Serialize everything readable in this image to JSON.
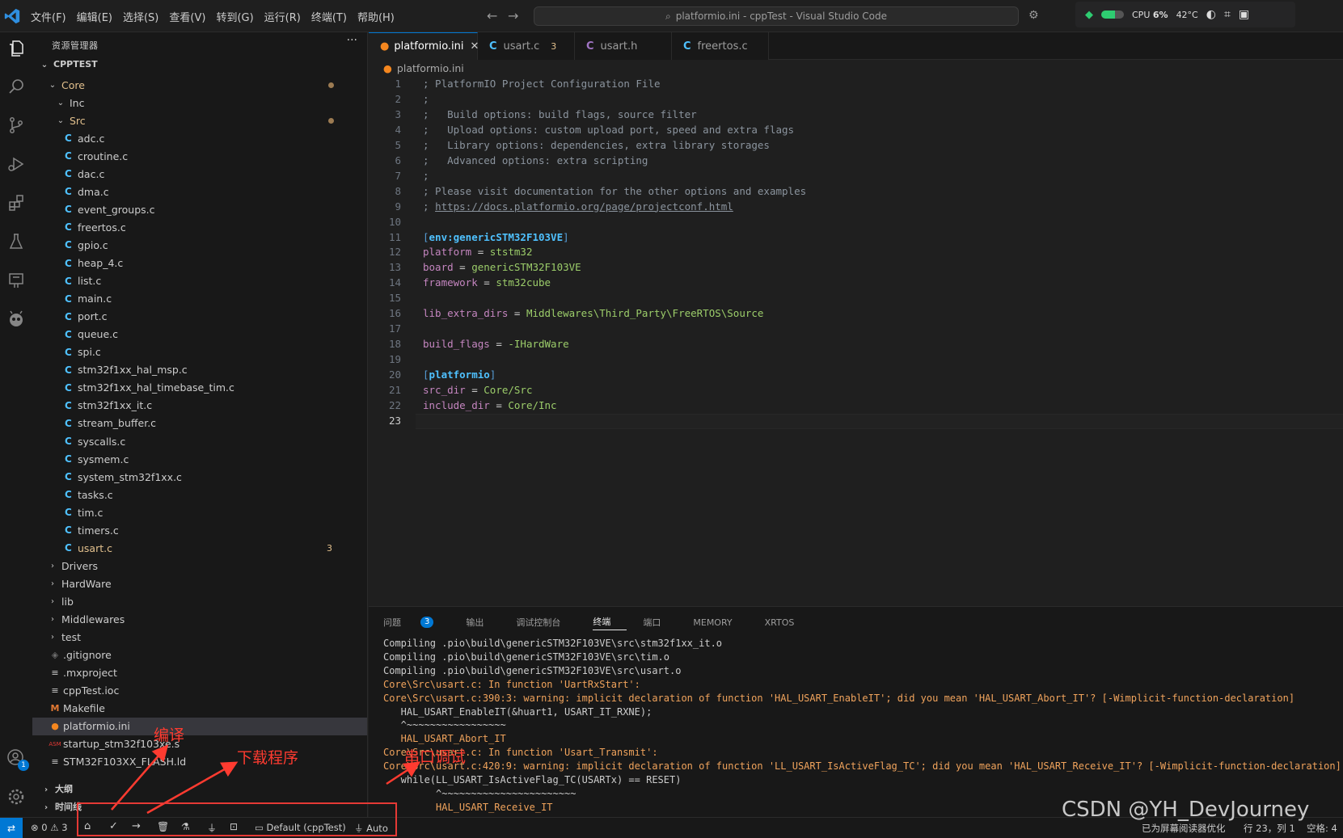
{
  "titlebar": {
    "menu": [
      "文件(F)",
      "编辑(E)",
      "选择(S)",
      "查看(V)",
      "转到(G)",
      "运行(R)",
      "终端(T)",
      "帮助(H)"
    ],
    "command_center": "platformio.ini - cppTest - Visual Studio Code",
    "cpu_label": "CPU",
    "cpu_value": "6%",
    "temperature": "42°C"
  },
  "activity_bar": {
    "icons": [
      "explorer-icon",
      "search-icon",
      "source-control-icon",
      "run-debug-icon",
      "extensions-icon",
      "testing-icon",
      "remote-explorer-icon",
      "platformio-icon"
    ],
    "bottom_icons": [
      "account-icon",
      "settings-icon"
    ],
    "account_badge": "1"
  },
  "sidebar": {
    "header": "资源管理器",
    "more": "···",
    "root": "CPPTEST",
    "items": [
      {
        "label": "Core",
        "type": "folder-open",
        "indent": 1,
        "color": "orange",
        "dot": true
      },
      {
        "label": "Inc",
        "type": "folder-open",
        "indent": 2
      },
      {
        "label": "Src",
        "type": "folder-open",
        "indent": 2,
        "color": "orange",
        "dot": true
      },
      {
        "label": "adc.c",
        "type": "c",
        "indent": 3
      },
      {
        "label": "croutine.c",
        "type": "c",
        "indent": 3
      },
      {
        "label": "dac.c",
        "type": "c",
        "indent": 3
      },
      {
        "label": "dma.c",
        "type": "c",
        "indent": 3
      },
      {
        "label": "event_groups.c",
        "type": "c",
        "indent": 3
      },
      {
        "label": "freertos.c",
        "type": "c",
        "indent": 3
      },
      {
        "label": "gpio.c",
        "type": "c",
        "indent": 3
      },
      {
        "label": "heap_4.c",
        "type": "c",
        "indent": 3
      },
      {
        "label": "list.c",
        "type": "c",
        "indent": 3
      },
      {
        "label": "main.c",
        "type": "c",
        "indent": 3
      },
      {
        "label": "port.c",
        "type": "c",
        "indent": 3
      },
      {
        "label": "queue.c",
        "type": "c",
        "indent": 3
      },
      {
        "label": "spi.c",
        "type": "c",
        "indent": 3
      },
      {
        "label": "stm32f1xx_hal_msp.c",
        "type": "c",
        "indent": 3
      },
      {
        "label": "stm32f1xx_hal_timebase_tim.c",
        "type": "c",
        "indent": 3
      },
      {
        "label": "stm32f1xx_it.c",
        "type": "c",
        "indent": 3
      },
      {
        "label": "stream_buffer.c",
        "type": "c",
        "indent": 3
      },
      {
        "label": "syscalls.c",
        "type": "c",
        "indent": 3
      },
      {
        "label": "sysmem.c",
        "type": "c",
        "indent": 3
      },
      {
        "label": "system_stm32f1xx.c",
        "type": "c",
        "indent": 3
      },
      {
        "label": "tasks.c",
        "type": "c",
        "indent": 3
      },
      {
        "label": "tim.c",
        "type": "c",
        "indent": 3
      },
      {
        "label": "timers.c",
        "type": "c",
        "indent": 3
      },
      {
        "label": "usart.c",
        "type": "c",
        "indent": 3,
        "color": "orange",
        "count": "3"
      },
      {
        "label": "Drivers",
        "type": "folder",
        "indent": 1
      },
      {
        "label": "HardWare",
        "type": "folder",
        "indent": 1
      },
      {
        "label": "lib",
        "type": "folder",
        "indent": 1
      },
      {
        "label": "Middlewares",
        "type": "folder",
        "indent": 1
      },
      {
        "label": "test",
        "type": "folder",
        "indent": 1
      },
      {
        "label": ".gitignore",
        "type": "git",
        "indent": 1
      },
      {
        "label": ".mxproject",
        "type": "text",
        "indent": 1
      },
      {
        "label": "cppTest.ioc",
        "type": "text",
        "indent": 1
      },
      {
        "label": "Makefile",
        "type": "make",
        "indent": 1
      },
      {
        "label": "platformio.ini",
        "type": "pio",
        "indent": 1,
        "selected": true
      },
      {
        "label": "startup_stm32f103xe.s",
        "type": "asm",
        "indent": 1
      },
      {
        "label": "STM32F103XX_FLASH.ld",
        "type": "text",
        "indent": 1
      }
    ],
    "outline": "大纲",
    "timeline": "时间线"
  },
  "editor": {
    "tabs": [
      {
        "label": "platformio.ini",
        "kind": "pio",
        "active": true
      },
      {
        "label": "usart.c",
        "kind": "c",
        "badge": "3"
      },
      {
        "label": "usart.h",
        "kind": "h"
      },
      {
        "label": "freertos.c",
        "kind": "c"
      }
    ],
    "breadcrumb": "platformio.ini",
    "lines": [
      "; PlatformIO Project Configuration File",
      ";",
      ";   Build options: build flags, source filter",
      ";   Upload options: custom upload port, speed and extra flags",
      ";   Library options: dependencies, extra library storages",
      ";   Advanced options: extra scripting",
      ";",
      "; Please visit documentation for the other options and examples",
      "; https://docs.platformio.org/page/projectconf.html",
      "",
      "[env:genericSTM32F103VE]",
      "platform = ststm32",
      "board = genericSTM32F103VE",
      "framework = stm32cube",
      "",
      "lib_extra_dirs = Middlewares\\Third_Party\\FreeRTOS\\Source",
      "",
      "build_flags = -IHardWare",
      "",
      "[platformio]",
      "src_dir = Core/Src",
      "include_dir = Core/Inc",
      ""
    ],
    "current_line": 23
  },
  "panel": {
    "tabs": [
      "问题",
      "输出",
      "调试控制台",
      "终端",
      "端口",
      "MEMORY",
      "XRTOS"
    ],
    "problems_badge": "3",
    "active_tab": "终端",
    "terminal_lines": [
      {
        "text": "Compiling .pio\\build\\genericSTM32F103VE\\src\\stm32f1xx_it.o",
        "warn": false
      },
      {
        "text": "Compiling .pio\\build\\genericSTM32F103VE\\src\\tim.o",
        "warn": false
      },
      {
        "text": "Compiling .pio\\build\\genericSTM32F103VE\\src\\usart.o",
        "warn": false
      },
      {
        "text": "Core\\Src\\usart.c: In function 'UartRxStart':",
        "warn": true
      },
      {
        "text": "Core\\Src\\usart.c:390:3: warning: implicit declaration of function 'HAL_USART_EnableIT'; did you mean 'HAL_USART_Abort_IT'? [-Wimplicit-function-declaration]",
        "warn": true
      },
      {
        "text": "   HAL_USART_EnableIT(&huart1, USART_IT_RXNE);",
        "warn": false
      },
      {
        "text": "   ^~~~~~~~~~~~~~~~~~",
        "warn": false
      },
      {
        "text": "   HAL_USART_Abort_IT",
        "warn": true
      },
      {
        "text": "Core\\Src\\usart.c: In function 'Usart_Transmit':",
        "warn": true
      },
      {
        "text": "Core\\Src\\usart.c:420:9: warning: implicit declaration of function 'LL_USART_IsActiveFlag_TC'; did you mean 'HAL_USART_Receive_IT'? [-Wimplicit-function-declaration]",
        "warn": true
      },
      {
        "text": "   while(LL_USART_IsActiveFlag_TC(USARTx) == RESET)",
        "warn": false
      },
      {
        "text": "         ^~~~~~~~~~~~~~~~~~~~~~~~",
        "warn": false
      },
      {
        "text": "         HAL_USART_Receive_IT",
        "warn": true
      }
    ]
  },
  "statusbar": {
    "errors": "0",
    "warnings": "3",
    "env": "Default (cppTest)",
    "port": "Auto",
    "screen_reader": "已为屏幕阅读器优化",
    "position": "行 23，列 1",
    "spaces": "空格: 4"
  },
  "annotations": {
    "compile": "编译",
    "upload": "下载程序",
    "serial": "串口调试"
  },
  "watermark": "CSDN @YH_DevJourney",
  "colors": {
    "accent": "#0078d4",
    "annotation": "#ff3b30",
    "warning": "#f0a35c"
  }
}
